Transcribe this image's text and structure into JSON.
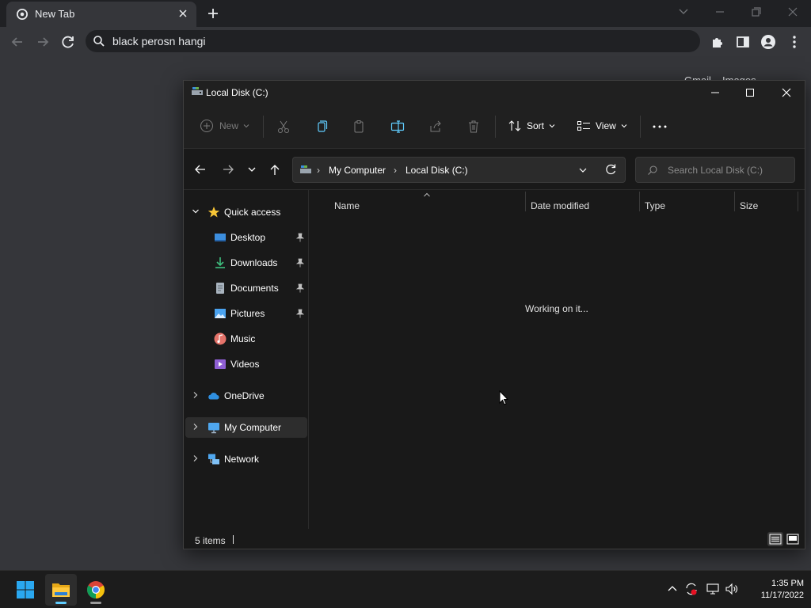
{
  "chrome": {
    "tab_title": "New Tab",
    "omnibox_text": "black perosn hangi",
    "ntp_links": [
      "Gmail",
      "Images"
    ]
  },
  "explorer": {
    "window_title": "Local Disk (C:)",
    "commands": {
      "new": "New",
      "sort": "Sort",
      "view": "View"
    },
    "breadcrumb": [
      "My Computer",
      "Local Disk (C:)"
    ],
    "search_placeholder": "Search Local Disk (C:)",
    "nav": {
      "quick_access": "Quick access",
      "pinned": [
        "Desktop",
        "Downloads",
        "Documents",
        "Pictures"
      ],
      "unpinned": [
        "Music",
        "Videos"
      ],
      "onedrive": "OneDrive",
      "my_computer": "My Computer",
      "network": "Network"
    },
    "columns": [
      "Name",
      "Date modified",
      "Type",
      "Size"
    ],
    "loading_text": "Working on it...",
    "status": "5 items"
  },
  "taskbar": {
    "time": "1:35 PM",
    "date": "11/17/2022"
  },
  "colors": {
    "chrome_frame": "#202124",
    "chrome_surface": "#35363a",
    "explorer_bg": "#191919",
    "taskbar": "#1c1c1c",
    "accent": "#60cdff"
  }
}
